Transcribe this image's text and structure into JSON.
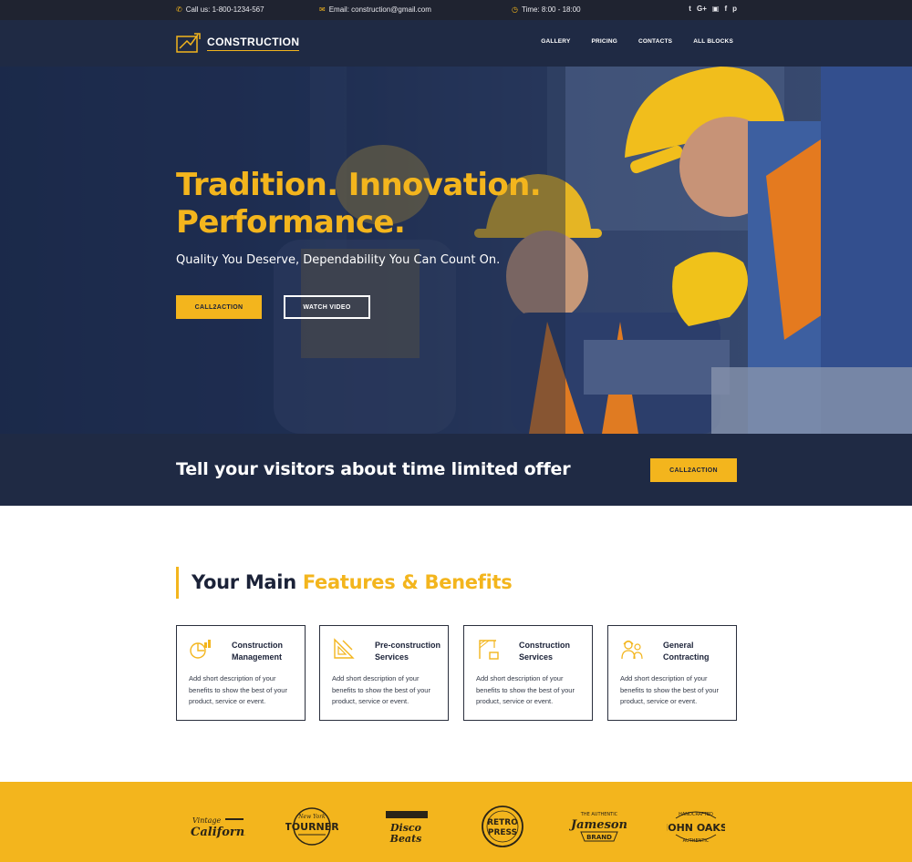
{
  "topbar": {
    "phone": "Call us: 1-800-1234-567",
    "email": "Email: construction@gmail.com",
    "time": "Time: 8:00 - 18:00",
    "social": [
      "twitter-icon",
      "google-plus-icon",
      "instagram-icon",
      "facebook-icon",
      "pinterest-icon"
    ]
  },
  "nav": {
    "brand": "CONSTRUCTION",
    "menu": [
      "GALLERY",
      "PRICING",
      "CONTACTS",
      "ALL BLOCKS"
    ]
  },
  "hero": {
    "title_line1": "Tradition. Innovation.",
    "title_line2": "Performance.",
    "subtitle": "Quality You Deserve, Dependability You Can Count On.",
    "primary_button": "CALL2ACTION",
    "secondary_button": "WATCH VIDEO"
  },
  "offer": {
    "text": "Tell your visitors about time limited offer",
    "button": "CALL2ACTION"
  },
  "features": {
    "title_plain": "Your Main",
    "title_accent": "Features & Benefits",
    "cards": [
      {
        "title": "Construction Management",
        "description": "Add short description of your benefits to show the best of your product, service or event.",
        "icon": "chart-icon"
      },
      {
        "title": "Pre-construction Services",
        "description": "Add short description of your benefits to show the best of your product, service or event.",
        "icon": "ruler-icon"
      },
      {
        "title": "Construction Services",
        "description": "Add short description of your benefits to show the best of your product, service or event.",
        "icon": "crane-icon"
      },
      {
        "title": "General Contracting",
        "description": "Add short description of your benefits to show the best of your product, service or event.",
        "icon": "workers-icon"
      }
    ]
  },
  "brands": [
    {
      "name": "Vintage California"
    },
    {
      "name": "New York TOURNER"
    },
    {
      "name": "Disco Beats"
    },
    {
      "name": "RETRO PRESS"
    },
    {
      "name": "The Authentic Jameson BRAND"
    },
    {
      "name": "Handcrafted JOHN OAKS Authentic"
    }
  ],
  "colors": {
    "accent": "#f3b51d",
    "navy": "#1f2a44",
    "topbar": "#1f2330"
  }
}
